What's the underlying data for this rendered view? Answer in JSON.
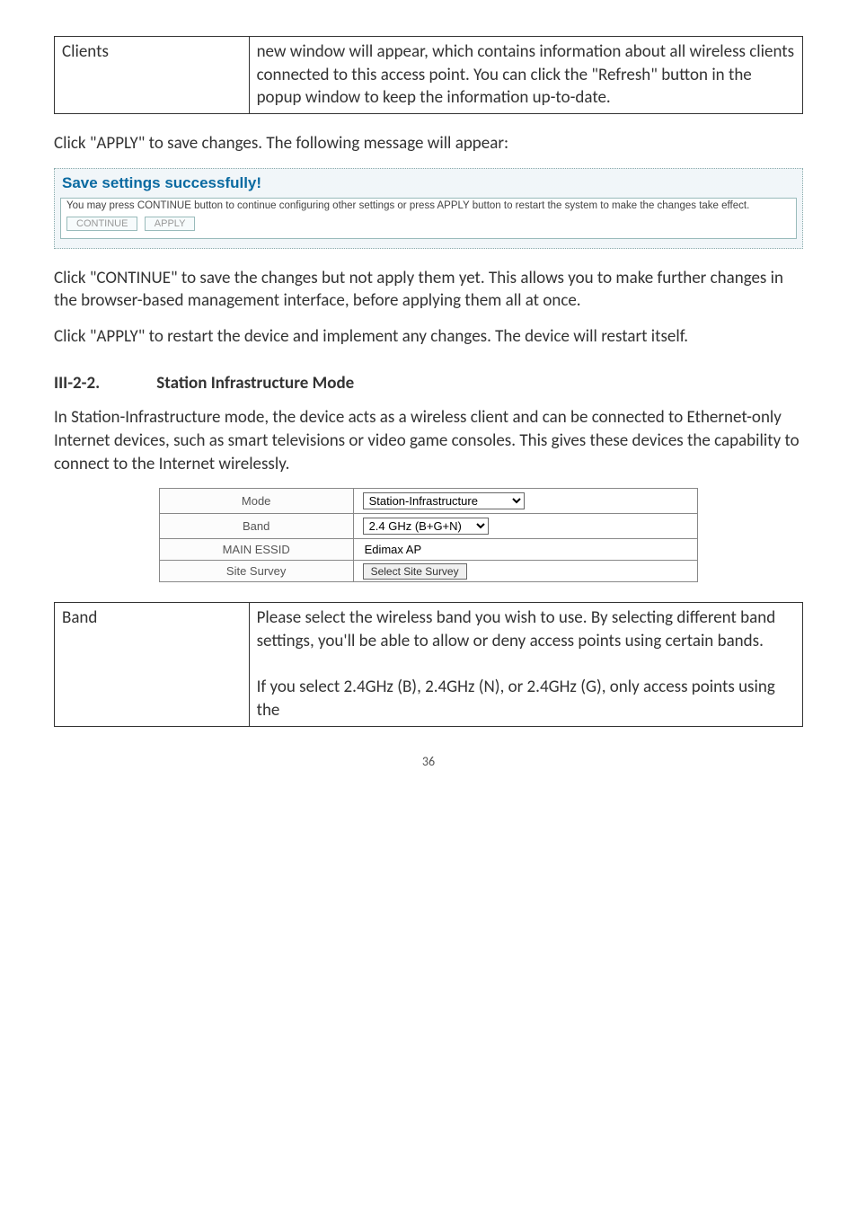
{
  "table1": {
    "label": "Clients",
    "desc": "new window will appear, which contains information about all wireless clients connected to this access point. You can click the \"Refresh\" button in the popup window to keep the information up-to-date."
  },
  "para1": "Click \"APPLY\" to save changes. The following message will appear:",
  "save_panel": {
    "title": "Save settings successfully!",
    "msg": "You may press CONTINUE button to continue configuring other settings or press APPLY button to restart the system to make the changes take effect.",
    "btn_continue": "CONTINUE",
    "btn_apply": "APPLY"
  },
  "para2": "Click \"CONTINUE\" to save the changes but not apply them yet. This allows you to make further changes in the browser-based management interface, before applying them all at once.",
  "para3": "Click \"APPLY\" to restart the device and implement any changes. The device will restart itself.",
  "heading": {
    "num": "III-2-2.",
    "title": "Station Infrastructure Mode"
  },
  "para4": "In Station-Infrastructure mode, the device acts as a wireless client and can be connected to Ethernet-only Internet devices, such as smart televisions or video game consoles. This gives these devices the capability to connect to the Internet wirelessly.",
  "config": {
    "mode_label": "Mode",
    "mode_value": "Station-Infrastructure",
    "band_label": "Band",
    "band_value": "2.4 GHz (B+G+N)",
    "essid_label": "MAIN ESSID",
    "essid_value": "Edimax AP",
    "survey_label": "Site Survey",
    "survey_btn": "Select Site Survey"
  },
  "table2": {
    "label": "Band",
    "desc1": "Please select the wireless band you wish to use. By selecting different band settings, you'll be able to allow or deny access points using certain bands.",
    "desc2": "If you select 2.4GHz (B), 2.4GHz (N), or 2.4GHz (G), only access points using the"
  },
  "page_num": "36"
}
